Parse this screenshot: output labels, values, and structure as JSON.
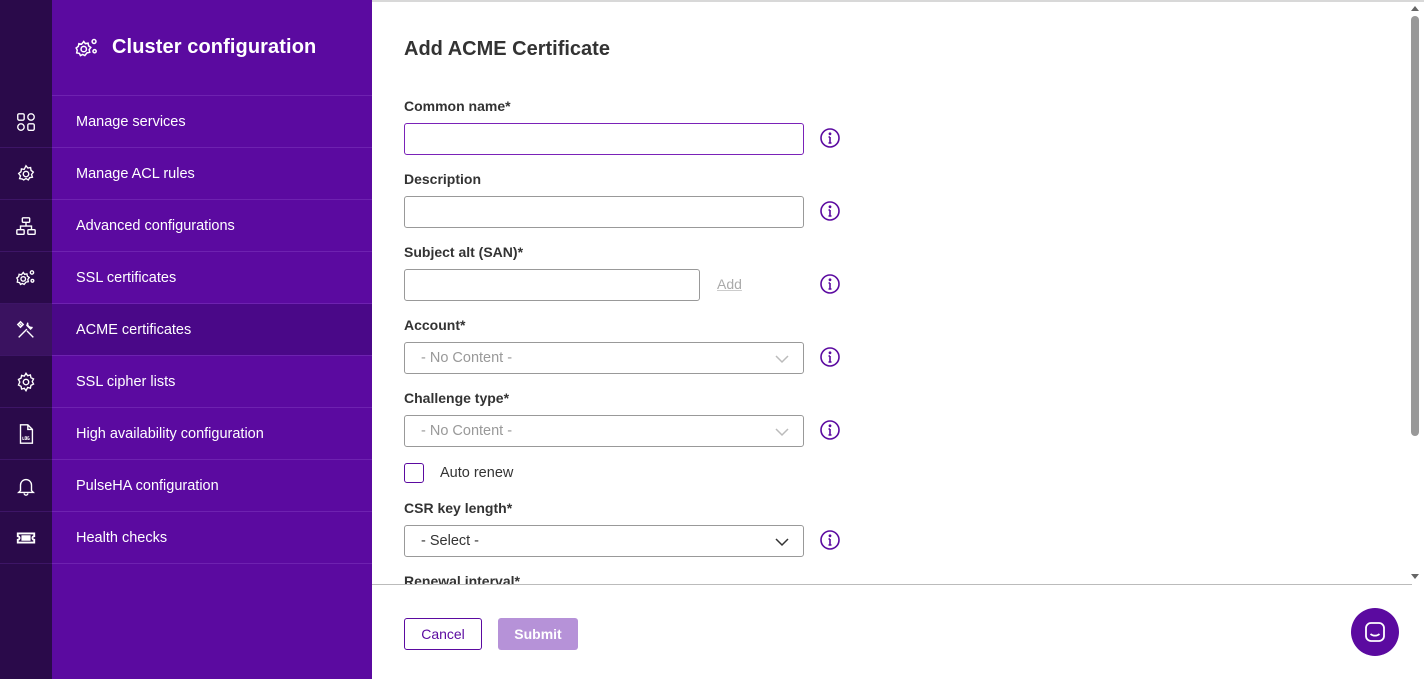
{
  "panel": {
    "title": "Cluster configuration",
    "icon": "gears-icon"
  },
  "nav": [
    {
      "label": "Manage services",
      "icon": "grid-icon"
    },
    {
      "label": "Manage ACL rules",
      "icon": "gear-shield-icon"
    },
    {
      "label": "Advanced configurations",
      "icon": "network-icon"
    },
    {
      "label": "SSL certificates",
      "icon": "gears-icon"
    },
    {
      "label": "ACME certificates",
      "icon": "tools-icon",
      "active": true
    },
    {
      "label": "SSL cipher lists",
      "icon": "gear-icon"
    },
    {
      "label": "High availability configuration",
      "icon": "log-file-icon"
    },
    {
      "label": "PulseHA configuration",
      "icon": "bell-icon"
    },
    {
      "label": "Health checks",
      "icon": "ticket-icon"
    }
  ],
  "form": {
    "title": "Add ACME Certificate",
    "common_name_label": "Common name*",
    "common_name_value": "",
    "description_label": "Description",
    "description_value": "",
    "san_label": "Subject alt (SAN)*",
    "san_value": "",
    "san_add_label": "Add",
    "account_label": "Account*",
    "account_value": "- No Content -",
    "challenge_label": "Challenge type*",
    "challenge_value": "- No Content -",
    "auto_renew_label": "Auto renew",
    "auto_renew_checked": false,
    "csr_label": "CSR key length*",
    "csr_value": "- Select -",
    "renewal_label": "Renewal interval*"
  },
  "footer": {
    "cancel_label": "Cancel",
    "submit_label": "Submit"
  },
  "colors": {
    "rail": "#2a0a4a",
    "panel": "#5b0aa0",
    "panel_active": "#4a0888",
    "submit_disabled": "#b692d8"
  }
}
